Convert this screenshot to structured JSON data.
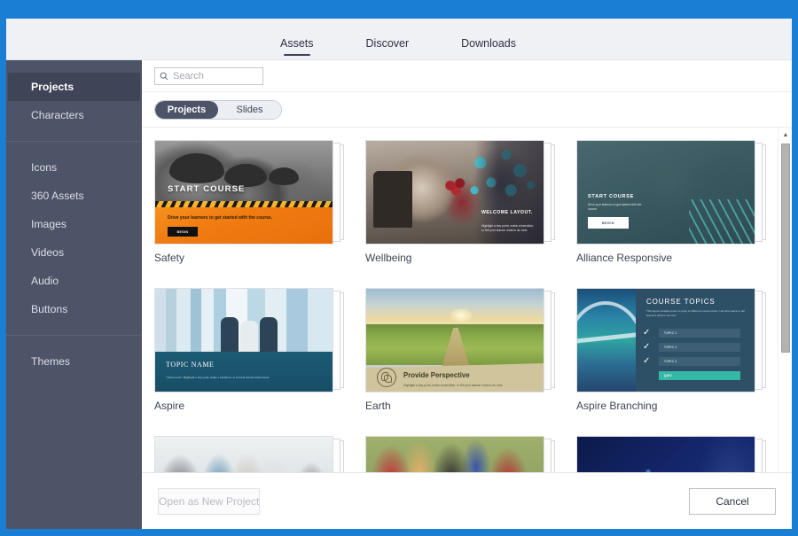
{
  "window": {
    "accent_color": "#1a7fd4",
    "header_bg": "#f0f1f5",
    "sidebar_bg": "#4e5468"
  },
  "tabs": [
    {
      "label": "Assets",
      "active": true
    },
    {
      "label": "Discover",
      "active": false
    },
    {
      "label": "Downloads",
      "active": false
    }
  ],
  "sidebar": {
    "group1": [
      {
        "label": "Projects",
        "active": true
      },
      {
        "label": "Characters",
        "active": false
      }
    ],
    "group2": [
      {
        "label": "Icons",
        "active": false
      },
      {
        "label": "360 Assets",
        "active": false
      },
      {
        "label": "Images",
        "active": false
      },
      {
        "label": "Videos",
        "active": false
      },
      {
        "label": "Audio",
        "active": false
      },
      {
        "label": "Buttons",
        "active": false
      }
    ],
    "group3": [
      {
        "label": "Themes",
        "active": false
      }
    ]
  },
  "search": {
    "value": "",
    "placeholder": "Search",
    "icon": "search-icon"
  },
  "segmented": {
    "options": [
      {
        "label": "Projects",
        "selected": true
      },
      {
        "label": "Slides",
        "selected": false
      }
    ]
  },
  "cards": [
    {
      "label": "Safety",
      "art": {
        "title": "START COURSE",
        "subtitle": "Drive your learners to get started with the course.",
        "button": "BEGIN"
      }
    },
    {
      "label": "Wellbeing",
      "art": {
        "title": "WELCOME LAYOUT.",
        "subtitle": "Highlight a key point, make a transition, or tell your learner what to do next."
      }
    },
    {
      "label": "Alliance Responsive",
      "art": {
        "title": "START COURSE",
        "subtitle": "Drive your learners to get started with the course.",
        "button": "BEGIN"
      }
    },
    {
      "label": "Aspire",
      "art": {
        "title": "TOPIC NAME",
        "subtitle": "\"What's next\" Highlight a key point, make a transition, or provide learner instructions."
      }
    },
    {
      "label": "Earth",
      "art": {
        "title": "Provide Perspective",
        "subtitle": "Highlight a key point, make a transition, or tell your learner what to do next."
      }
    },
    {
      "label": "Aspire Branching",
      "art": {
        "title": "COURSE TOPICS",
        "subtitle": "This layout enables users to jump to different course topics. Use this space to tell learners what to do next.",
        "rows": [
          "TOPIC 1",
          "TOPIC 2",
          "TOPIC 3"
        ],
        "quiz": "QUIZ"
      }
    }
  ],
  "scrollbar": {
    "up_arrow": "▲",
    "down_arrow": "▼"
  },
  "footer": {
    "open_label": "Open as New Project",
    "cancel_label": "Cancel"
  }
}
